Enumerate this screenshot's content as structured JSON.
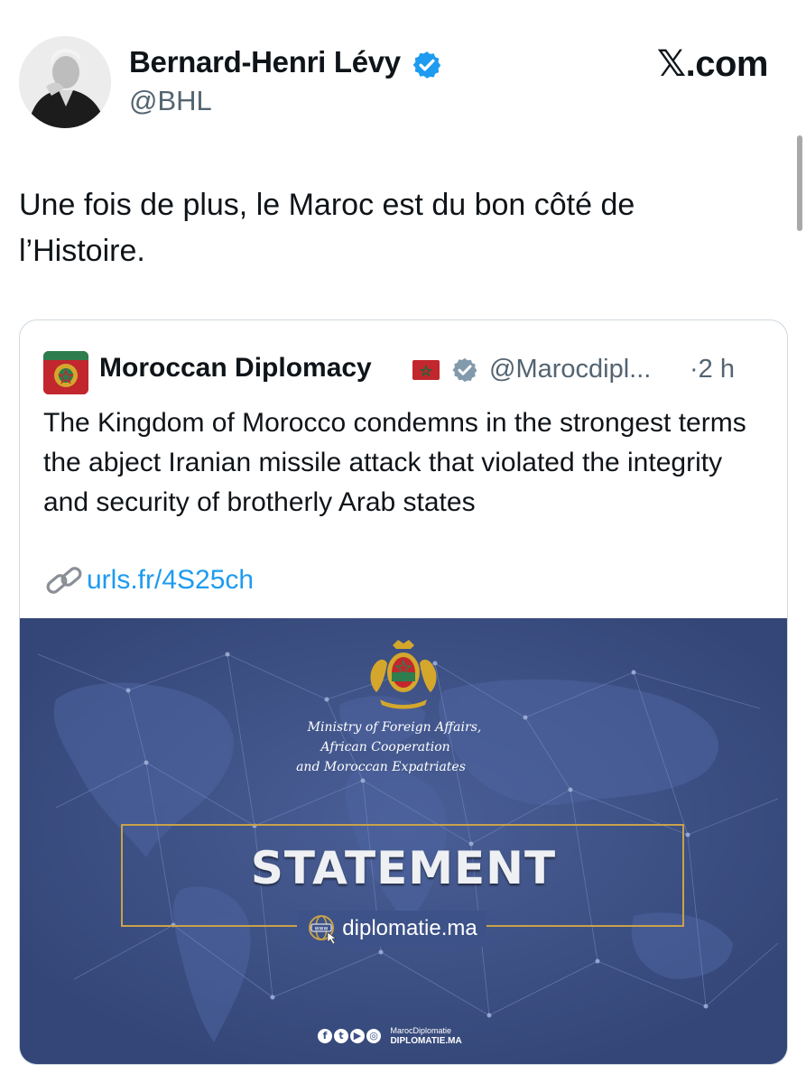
{
  "author": {
    "name": "Bernard-Henri Lévy",
    "handle": "@BHL",
    "verified": true
  },
  "site_logo": {
    "mark": "𝕏",
    "domain": ".com"
  },
  "tweet": {
    "text": "Une fois de plus, le Maroc est du bon côté de l’Histoire."
  },
  "quote": {
    "name": "Moroccan Diplomacy",
    "flag": "morocco-flag",
    "verified": true,
    "handle": "@Marocdipl...",
    "time": "·2 h",
    "text": "The Kingdom of Morocco condemns in the strongest terms the abject Iranian missile attack that violated the integrity and security of brotherly Arab states",
    "link_text": "urls.fr/4S25ch",
    "media": {
      "ministry_line1": "Ministry of Foreign Affairs,",
      "ministry_line2": "African Cooperation",
      "ministry_line3": "and Moroccan Expatriates",
      "statement": "STATEMENT",
      "website": "diplomatie.ma",
      "social_handle": "MarocDiplomatie",
      "social_site": "DIPLOMATIE.MA"
    }
  },
  "colors": {
    "link": "#1d9bf0",
    "verified": "#1d9bf0",
    "media_background": "#3d5288",
    "frame_gold": "#c9a24a"
  }
}
